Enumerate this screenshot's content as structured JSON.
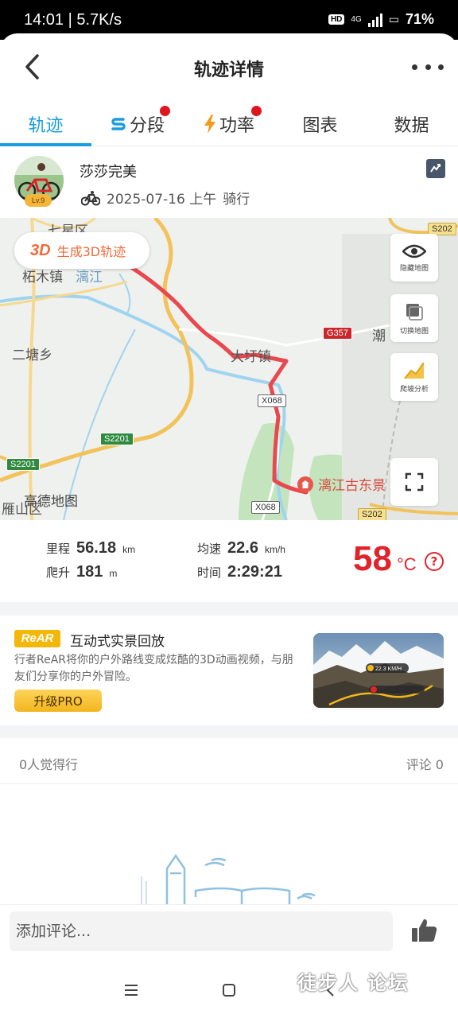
{
  "status_bar": {
    "time": "14:01 | 5.7K/s",
    "network": "4G",
    "hd_badge": "HD",
    "battery": "71%"
  },
  "header": {
    "title": "轨迹详情"
  },
  "tabs": [
    {
      "label": "轨迹",
      "active": true
    },
    {
      "label": "分段",
      "icon": "segment-s-icon",
      "has_dot": true
    },
    {
      "label": "功率",
      "icon": "lightning-icon",
      "has_dot": true
    },
    {
      "label": "图表"
    },
    {
      "label": "数据"
    }
  ],
  "user": {
    "name": "莎莎完美",
    "level": "Lv.9",
    "date_time": "2025-07-16 上午",
    "activity": "骑行"
  },
  "map": {
    "button_3d": {
      "badge": "3D",
      "label": "生成3D轨迹"
    },
    "tools": [
      {
        "label": "隐藏地图",
        "icon": "eye-icon"
      },
      {
        "label": "切换地图",
        "icon": "layers-icon"
      },
      {
        "label": "爬坡分析",
        "icon": "climb-chart-icon"
      }
    ],
    "expand_icon": "fullscreen-icon",
    "places": {
      "qixing": "七星区",
      "zhemu": "柘木镇",
      "lijiang": "漓江",
      "ertang": "二塘乡",
      "daxu": "大圩镇",
      "chao": "潮",
      "yanshan": "雁山区",
      "poi": "漓江古东景"
    },
    "roads": {
      "s202_top": "S202",
      "g357": "G357",
      "x068_mid": "X068",
      "s2201_mid": "S2201",
      "s2201_left": "S2201",
      "x068_bottom": "X068",
      "s202_bottom": "S202"
    },
    "attribution": "高德地图",
    "colors": {
      "track": "#e8484e",
      "river": "#9fd4f0",
      "road_major": "#f2c25b",
      "park": "#bfe3b7"
    }
  },
  "stats": {
    "distance": {
      "label": "里程",
      "value": "56.18",
      "unit": "km"
    },
    "avg_speed": {
      "label": "均速",
      "value": "22.6",
      "unit": "km/h"
    },
    "climb": {
      "label": "爬升",
      "value": "181",
      "unit": "m"
    },
    "duration": {
      "label": "时间",
      "value": "2:29:21"
    },
    "temperature": {
      "value": "58",
      "unit": "°C"
    }
  },
  "promo": {
    "logo": "ReAR",
    "title": "互动式实景回放",
    "description": "行者ReAR将你的户外路线变成炫酷的3D动画视频，与朋友们分享你的户外冒险。",
    "button": "升级PRO",
    "image_speed": "22.3 KM/H"
  },
  "social": {
    "likes": "0人觉得行",
    "comments": "评论 0"
  },
  "comment": {
    "placeholder": "添加评论..."
  },
  "watermark": {
    "text": "徒步人 论坛"
  }
}
